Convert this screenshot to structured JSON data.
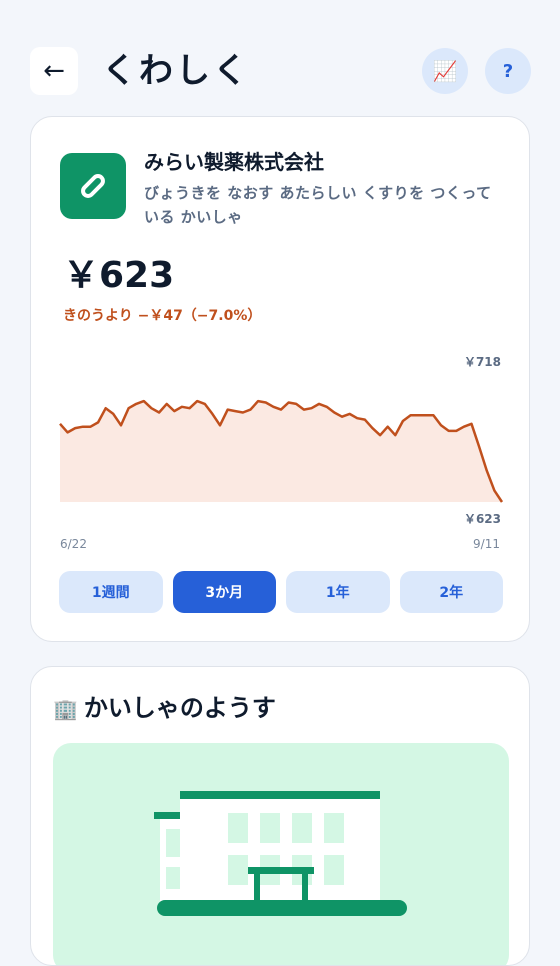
{
  "header": {
    "back_icon": "←",
    "title": "くわしく",
    "chart_icon": "📈",
    "help_label": "?"
  },
  "stock": {
    "company_name": "みらい製薬株式会社",
    "description": "びょうきを なおす あたらしい くすりを つくって いる かいしゃ",
    "price": "￥623",
    "change": "きのうより −￥47（−7.0%）",
    "logo_icon": "pill-icon",
    "accent_color": "#0f9466",
    "down_color": "#c0501d"
  },
  "chart_data": {
    "type": "area",
    "x_start_label": "6/22",
    "x_end_label": "9/11",
    "max_label": "￥718",
    "min_label": "￥623",
    "ylim": [
      623,
      718
    ],
    "values": [
      678,
      672,
      675,
      676,
      676,
      679,
      689,
      685,
      677,
      689,
      692,
      694,
      689,
      686,
      692,
      687,
      690,
      689,
      694,
      692,
      685,
      677,
      688,
      687,
      686,
      688,
      694,
      693,
      690,
      688,
      693,
      692,
      688,
      689,
      692,
      690,
      686,
      683,
      685,
      682,
      681,
      675,
      670,
      676,
      670,
      680,
      684,
      684,
      684,
      684,
      677,
      673,
      673,
      676,
      678,
      662,
      645,
      631,
      623
    ],
    "grid": false,
    "legend": "none"
  },
  "periods": {
    "options": [
      "1週間",
      "3か月",
      "1年",
      "2年"
    ],
    "selected": "3か月"
  },
  "company_section": {
    "icon": "🏢",
    "title": "かいしゃのようす"
  }
}
